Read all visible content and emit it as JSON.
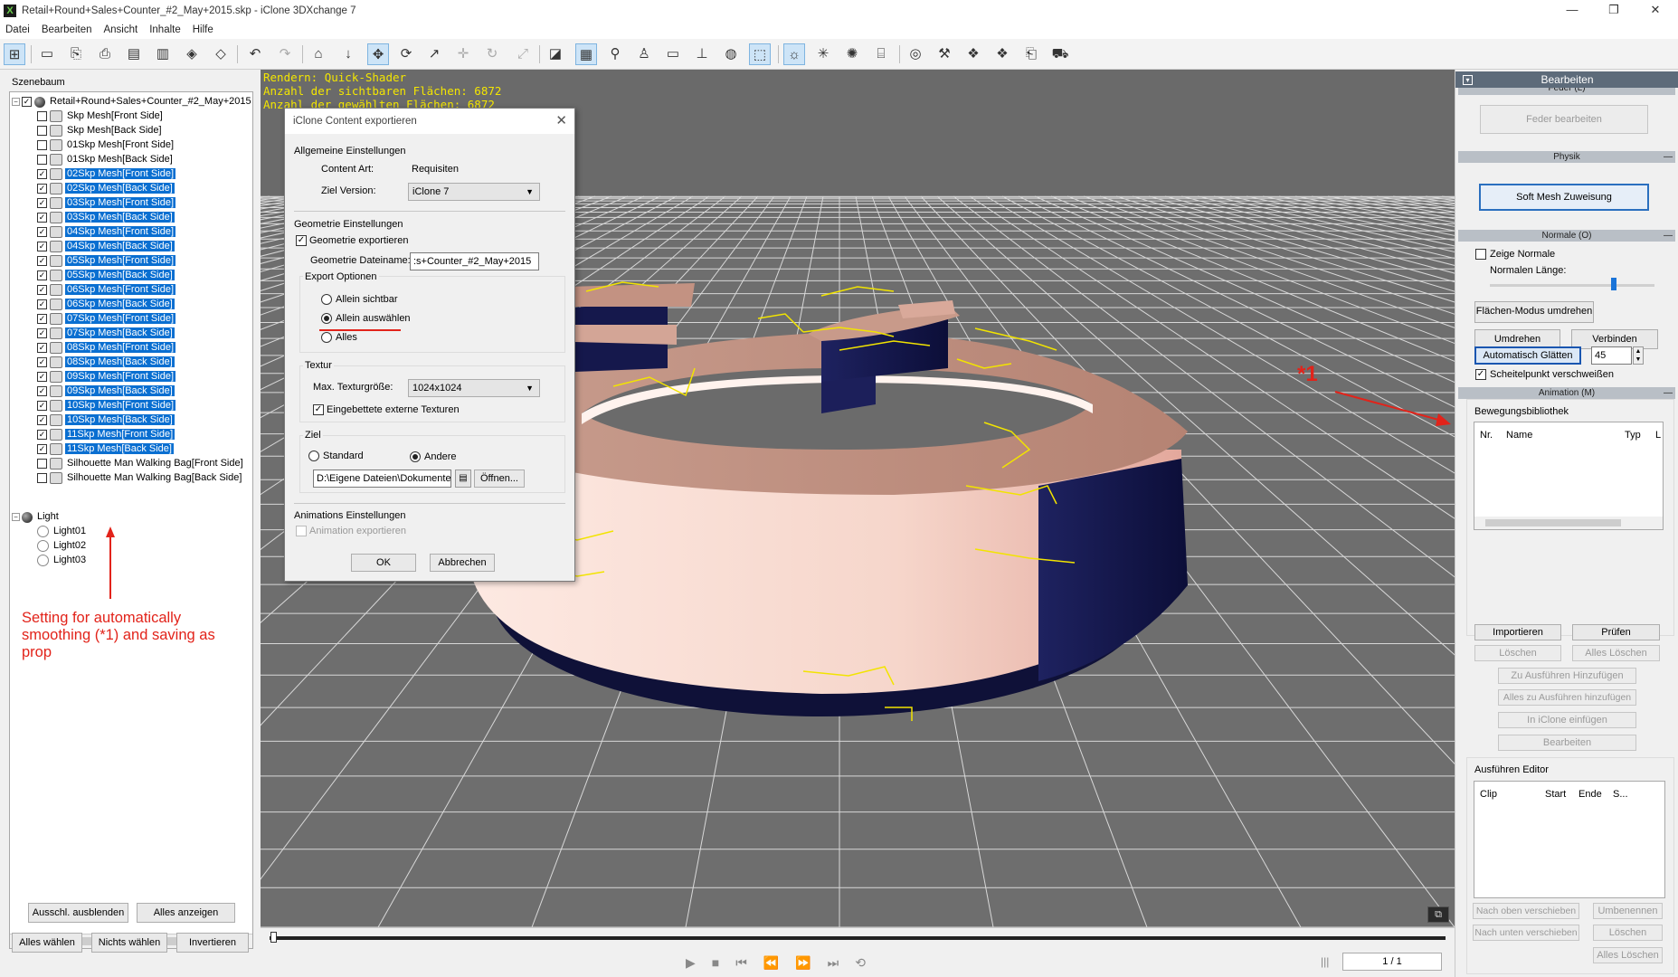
{
  "window": {
    "title": "Retail+Round+Sales+Counter_#2_May+2015.skp - iClone 3DXchange 7",
    "logo": "X",
    "controls": [
      "—",
      "❐",
      "✕"
    ]
  },
  "menu": [
    "Datei",
    "Bearbeiten",
    "Ansicht",
    "Inhalte",
    "Hilfe"
  ],
  "scene_panel": {
    "header": "Szenebaum",
    "root": "Retail+Round+Sales+Counter_#2_May+2015",
    "items": [
      {
        "label": "Skp Mesh[Front Side]",
        "checked": false,
        "selected": false
      },
      {
        "label": "Skp Mesh[Back Side]",
        "checked": false,
        "selected": false
      },
      {
        "label": "01Skp Mesh[Front Side]",
        "checked": false,
        "selected": false
      },
      {
        "label": "01Skp Mesh[Back Side]",
        "checked": false,
        "selected": false
      },
      {
        "label": "02Skp Mesh[Front Side]",
        "checked": true,
        "selected": true
      },
      {
        "label": "02Skp Mesh[Back Side]",
        "checked": true,
        "selected": true
      },
      {
        "label": "03Skp Mesh[Front Side]",
        "checked": true,
        "selected": true
      },
      {
        "label": "03Skp Mesh[Back Side]",
        "checked": true,
        "selected": true
      },
      {
        "label": "04Skp Mesh[Front Side]",
        "checked": true,
        "selected": true
      },
      {
        "label": "04Skp Mesh[Back Side]",
        "checked": true,
        "selected": true
      },
      {
        "label": "05Skp Mesh[Front Side]",
        "checked": true,
        "selected": true
      },
      {
        "label": "05Skp Mesh[Back Side]",
        "checked": true,
        "selected": true
      },
      {
        "label": "06Skp Mesh[Front Side]",
        "checked": true,
        "selected": true
      },
      {
        "label": "06Skp Mesh[Back Side]",
        "checked": true,
        "selected": true
      },
      {
        "label": "07Skp Mesh[Front Side]",
        "checked": true,
        "selected": true
      },
      {
        "label": "07Skp Mesh[Back Side]",
        "checked": true,
        "selected": true
      },
      {
        "label": "08Skp Mesh[Front Side]",
        "checked": true,
        "selected": true
      },
      {
        "label": "08Skp Mesh[Back Side]",
        "checked": true,
        "selected": true
      },
      {
        "label": "09Skp Mesh[Front Side]",
        "checked": true,
        "selected": true
      },
      {
        "label": "09Skp Mesh[Back Side]",
        "checked": true,
        "selected": true
      },
      {
        "label": "10Skp Mesh[Front Side]",
        "checked": true,
        "selected": true
      },
      {
        "label": "10Skp Mesh[Back Side]",
        "checked": true,
        "selected": true
      },
      {
        "label": "11Skp Mesh[Front Side]",
        "checked": true,
        "selected": true
      },
      {
        "label": "11Skp Mesh[Back Side]",
        "checked": true,
        "selected": true
      },
      {
        "label": "Silhouette Man Walking Bag[Front Side]",
        "checked": false,
        "selected": false
      },
      {
        "label": "Silhouette Man Walking Bag[Back Side]",
        "checked": false,
        "selected": false
      }
    ],
    "light_group": "Light",
    "lights": [
      "Light01",
      "Light02",
      "Light03"
    ],
    "buttons": {
      "hide_selected": "Ausschl. ausblenden",
      "show_all": "Alles anzeigen",
      "select_all": "Alles wählen",
      "select_none": "Nichts wählen",
      "invert": "Invertieren"
    },
    "scroll_left": "<",
    "scroll_right": ">"
  },
  "annotation": "Setting for automatically smoothing (*1) and saving as prop",
  "annotation_marker": "*1",
  "viewport": {
    "hud": [
      "Rendern: Quick-Shader",
      "Anzahl der sichtbaren Flächen: 6872",
      "Anzahl der gewählten Flächen: 6872"
    ]
  },
  "timeline": {
    "frame": "1 / 1"
  },
  "dialog": {
    "title": "iClone Content exportieren",
    "general_header": "Allgemeine Einstellungen",
    "content_type_label": "Content Art:",
    "content_type_value": "Requisiten",
    "target_version_label": "Ziel Version:",
    "target_version_value": "iClone 7",
    "geometry_header": "Geometrie Einstellungen",
    "export_geometry": "Geometrie exportieren",
    "geometry_filename_label": "Geometrie Dateiname:",
    "geometry_filename_value": ":s+Counter_#2_May+2015",
    "export_options_header": "Export Optionen",
    "opt_visible": "Allein sichtbar",
    "opt_selected": "Allein auswählen",
    "opt_all": "Alles",
    "texture_header": "Textur",
    "max_texture_label": "Max. Texturgröße:",
    "max_texture_value": "1024x1024",
    "embed_textures": "Eingebettete externe Texturen",
    "target_header": "Ziel",
    "target_standard": "Standard",
    "target_other": "Andere",
    "target_path": "D:\\Eigene Dateien\\Dokumente",
    "open_button": "Öffnen...",
    "animation_header": "Animations Einstellungen",
    "export_animation": "Animation exportieren",
    "ok": "OK",
    "cancel": "Abbrechen",
    "close": "✕"
  },
  "right_panel": {
    "title": "Bearbeiten",
    "feder_section": "Feder (L)",
    "feder_button": "Feder bearbeiten",
    "physik_section": "Physik",
    "soft_mesh_button": "Soft Mesh Zuweisung",
    "normale_section": "Normale (O)",
    "show_normals": "Zeige Normale",
    "normal_length_label": "Normalen Länge:",
    "normal_length": 0.75,
    "flip_face_mode": "Flächen-Modus umdrehen",
    "flip": "Umdrehen",
    "connect": "Verbinden",
    "auto_smooth": "Automatisch Glätten",
    "smooth_angle": "45",
    "weld_vertices": "Scheitelpunkt verschweißen",
    "animation_section": "Animation (M)",
    "motion_library_label": "Bewegungsbibliothek",
    "motion_columns": [
      "Nr.",
      "Name",
      "Typ",
      "L"
    ],
    "import": "Importieren",
    "check": "Prüfen",
    "delete": "Löschen",
    "delete_all": "Alles Löschen",
    "add_to_perform": "Zu Ausführen Hinzufügen",
    "add_all_to_perform": "Alles zu Ausführen hinzufügen",
    "insert_iclone": "In iClone einfügen",
    "edit": "Bearbeiten",
    "perform_editor_label": "Ausführen Editor",
    "perform_columns": [
      "Clip",
      "Start",
      "Ende",
      "S..."
    ],
    "move_up": "Nach oben verschieben",
    "rename": "Umbenennen",
    "move_down": "Nach unten verschieben",
    "delete2": "Löschen",
    "delete_all2": "Alles Löschen"
  },
  "colors": {
    "selection": "#0a6fd1",
    "hud_text": "#f4e600",
    "annotation": "#e2231a",
    "viewport_bg": "#6e6e6e",
    "counter_top": "#c89a8a",
    "counter_side": "#f3cfc4",
    "counter_dark": "#14164a"
  }
}
